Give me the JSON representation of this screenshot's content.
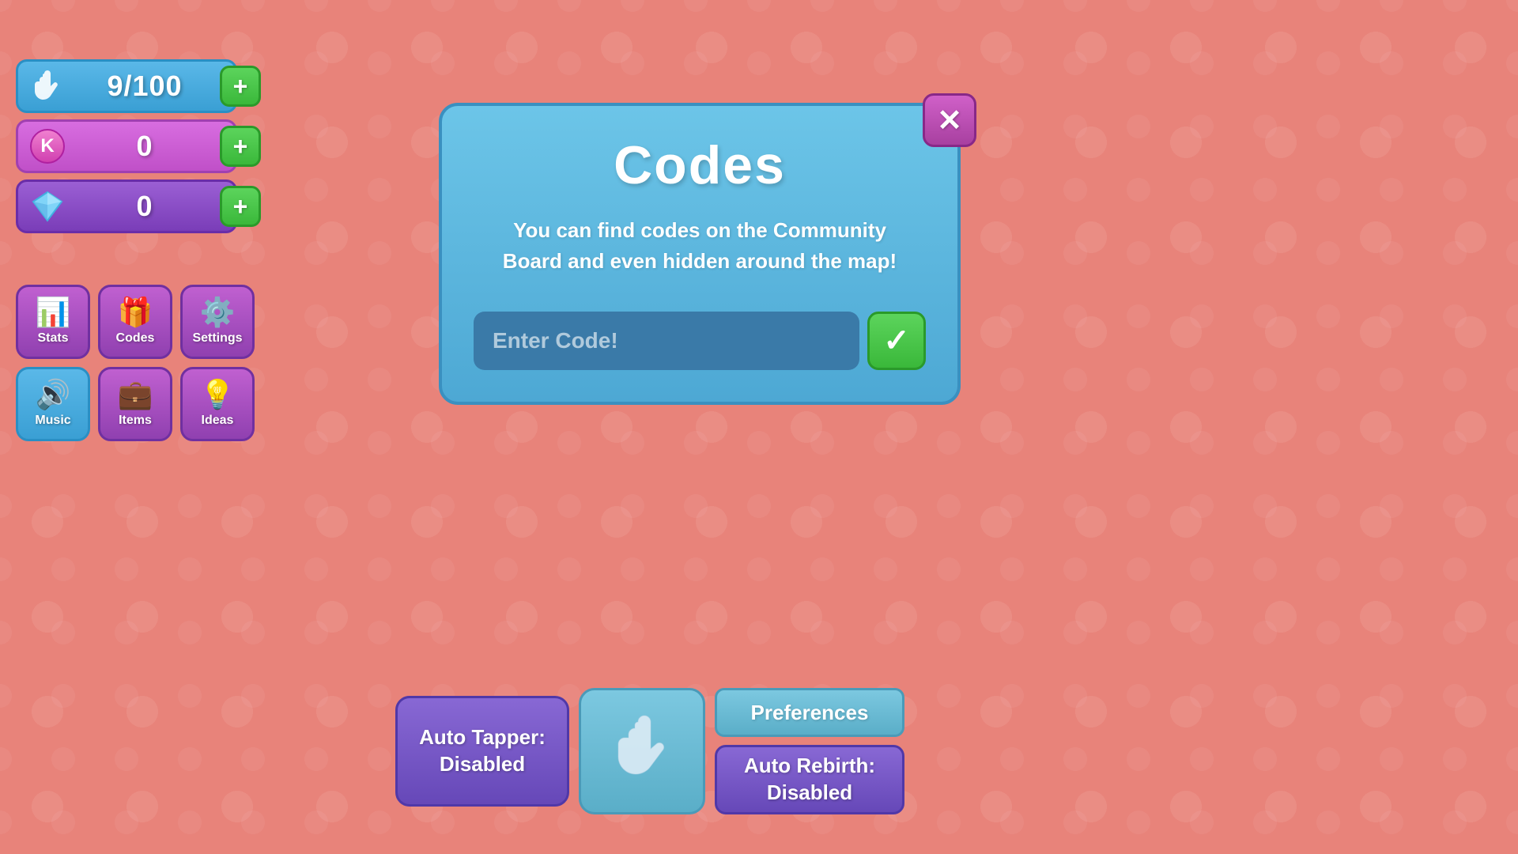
{
  "stats": {
    "clicks": {
      "value": "9/100",
      "plus_label": "+"
    },
    "kcash": {
      "value": "0",
      "plus_label": "+"
    },
    "gems": {
      "value": "0",
      "plus_label": "+"
    }
  },
  "menu": {
    "stats_label": "Stats",
    "codes_label": "Codes",
    "settings_label": "Settings",
    "music_label": "Music",
    "items_label": "Items",
    "ideas_label": "Ideas"
  },
  "codes_modal": {
    "title": "Codes",
    "description": "You can find codes on the Community Board and even hidden around the map!",
    "input_placeholder": "Enter Code!",
    "submit_icon": "✓",
    "close_icon": "✕"
  },
  "bottom_bar": {
    "auto_tapper_label": "Auto Tapper:\nDisabled",
    "preferences_label": "Preferences",
    "auto_rebirth_label": "Auto Rebirth:\nDisabled"
  },
  "colors": {
    "bg": "#e8837a",
    "blue": "#5ab8e8",
    "purple": "#9040b0",
    "green": "#3ab83a",
    "pink_close": "#a840a0"
  },
  "icons": {
    "stats": "📊",
    "codes": "🎁",
    "settings": "⚙️",
    "music": "🔊",
    "ideas": "💡"
  }
}
